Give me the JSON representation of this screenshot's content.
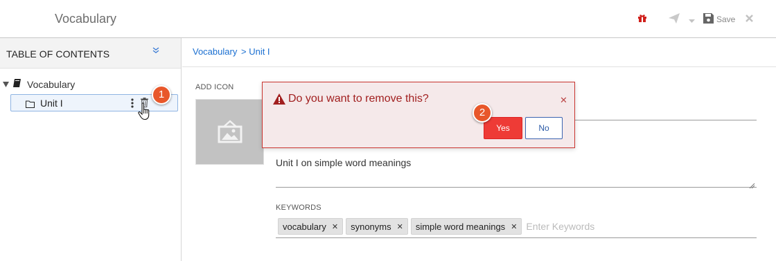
{
  "app": {
    "title": "Vocabulary"
  },
  "toolbar": {
    "save_label": "Save",
    "icons": [
      "gift-icon",
      "send-icon",
      "caret-down-icon",
      "save-icon",
      "close-icon"
    ]
  },
  "sidebar": {
    "title": "TABLE OF CONTENTS",
    "tree": {
      "root_label": "Vocabulary",
      "children": [
        {
          "label": "Unit I",
          "selected": true
        }
      ]
    }
  },
  "breadcrumb": {
    "root": "Vocabulary",
    "current": "> Unit I"
  },
  "form": {
    "add_icon_label": "ADD ICON",
    "description_value": "Unit I on simple word meanings",
    "keywords_label": "KEYWORDS",
    "keywords": [
      "vocabulary",
      "synonyms",
      "simple word meanings"
    ],
    "keywords_placeholder": "Enter Keywords"
  },
  "dialog": {
    "message": "Do you want to remove this?",
    "yes_label": "Yes",
    "no_label": "No"
  },
  "callouts": {
    "step1": "1",
    "step2": "2"
  },
  "colors": {
    "accent_link": "#1a6fd1",
    "danger": "#ee3b36",
    "badge": "#e8572a",
    "dialog_bg": "#f5e9ea"
  }
}
